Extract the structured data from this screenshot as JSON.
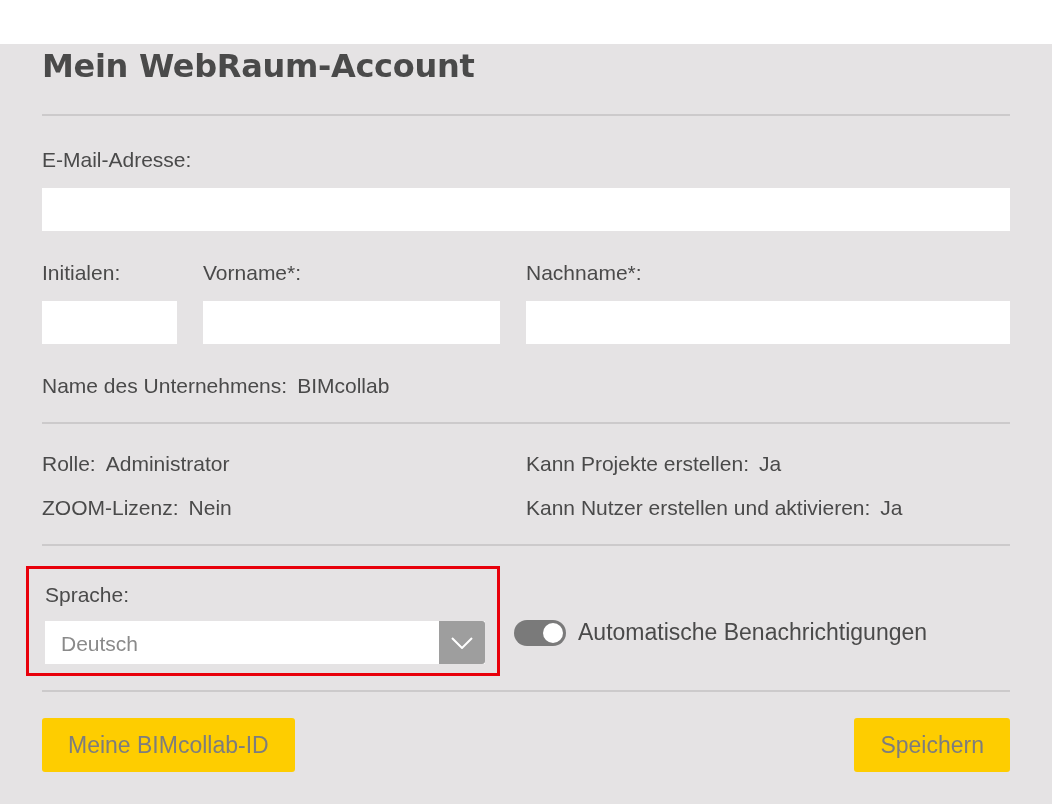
{
  "title": "Mein WebRaum-Account",
  "email": {
    "label": "E-Mail-Adresse:"
  },
  "name_fields": [
    {
      "label": "Initialen:"
    },
    {
      "label": "Vorname*:"
    },
    {
      "label": "Nachname*:"
    }
  ],
  "company": {
    "label": "Name des Unternehmens:",
    "value": "BIMcollab"
  },
  "info": [
    {
      "label": "Rolle:",
      "value": "Administrator"
    },
    {
      "label": "Kann Projekte erstellen:",
      "value": "Ja"
    },
    {
      "label": "ZOOM-Lizenz:",
      "value": "Nein"
    },
    {
      "label": "Kann Nutzer erstellen und aktivieren:",
      "value": "Ja"
    }
  ],
  "language": {
    "label": "Sprache:",
    "value": "Deutsch",
    "highlighted": true
  },
  "notifications": {
    "label": "Automatische Benachrichtigungen",
    "on": true
  },
  "buttons": [
    {
      "label": "Meine BIMcollab-ID"
    },
    {
      "label": "Speichern"
    }
  ]
}
